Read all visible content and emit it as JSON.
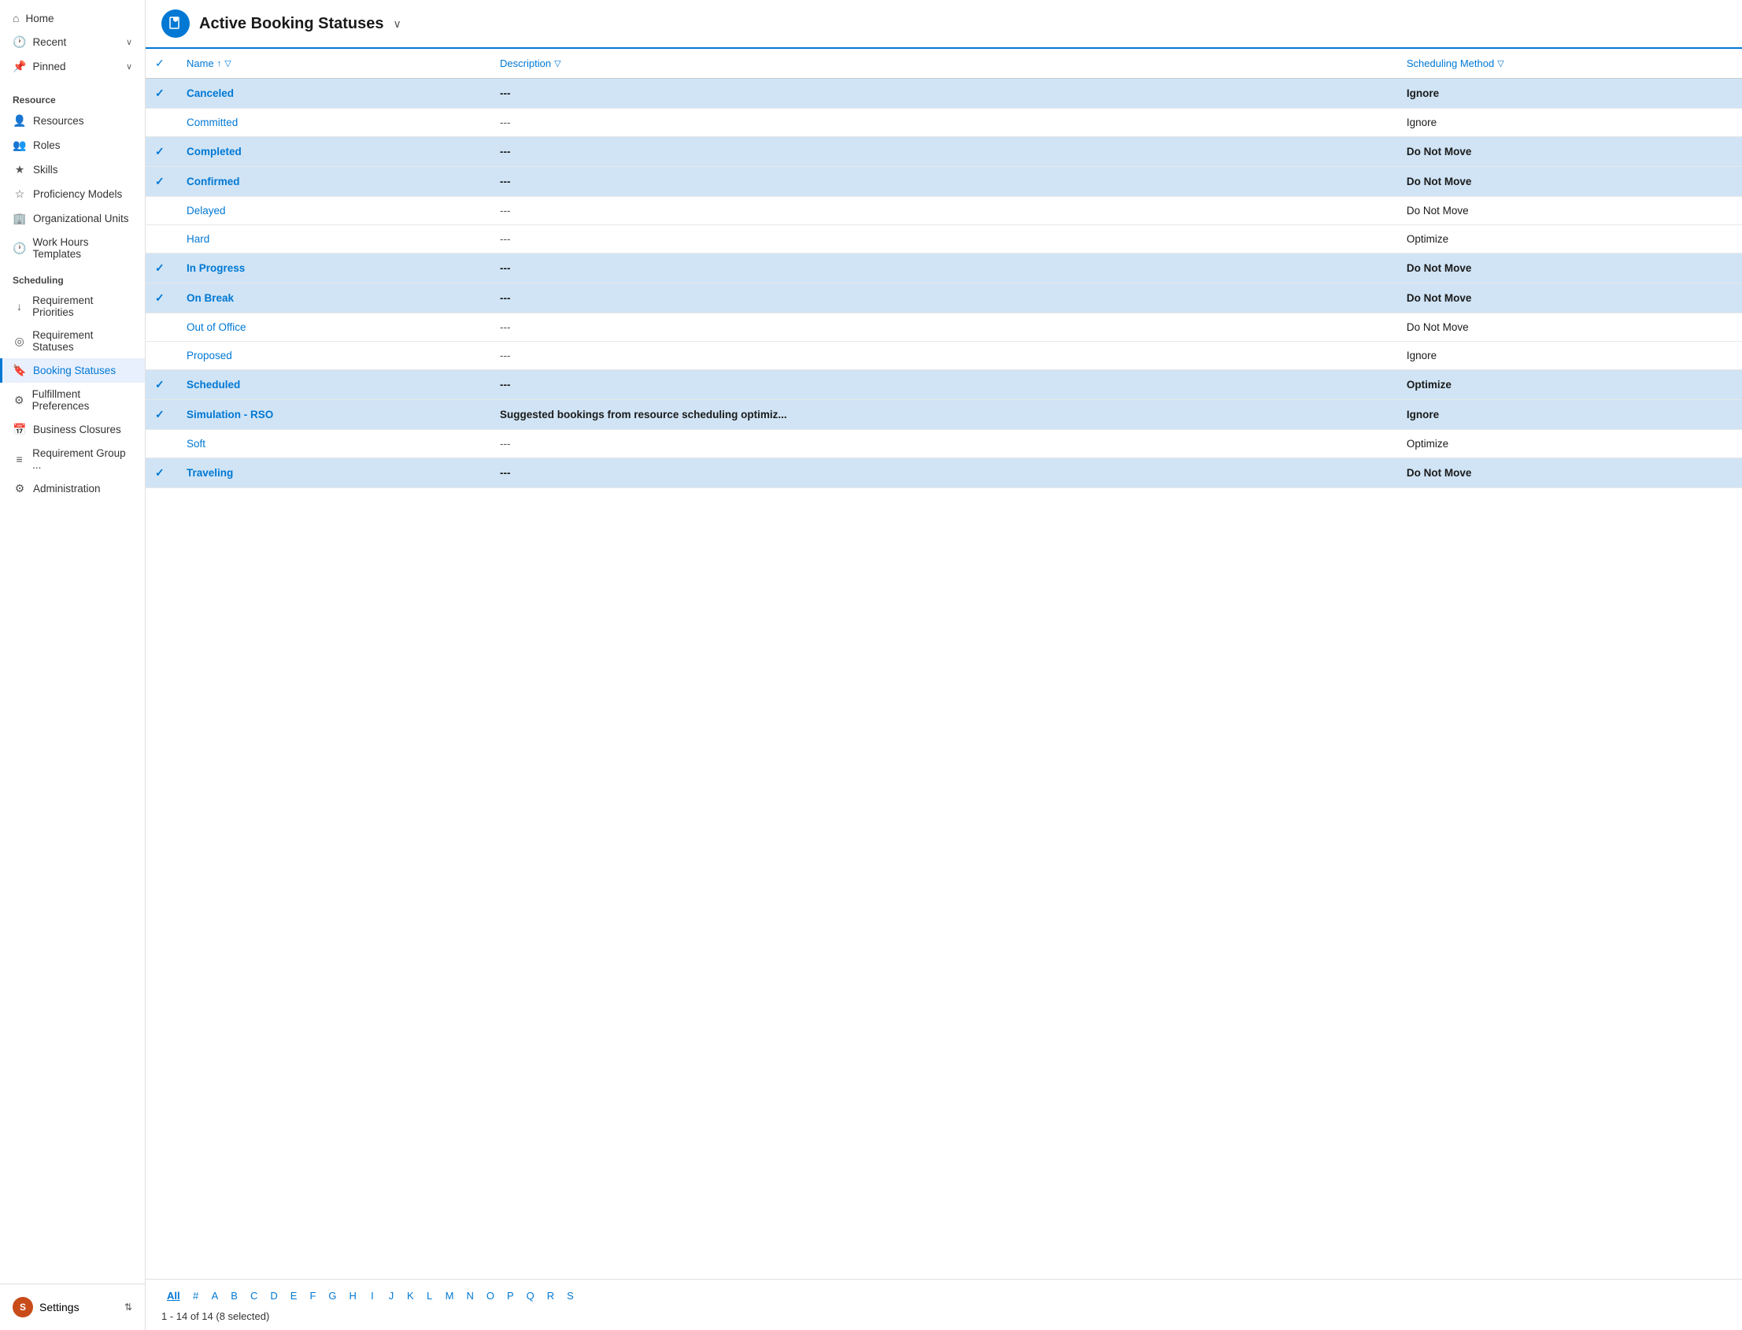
{
  "sidebar": {
    "nav": [
      {
        "id": "home",
        "label": "Home",
        "icon": "⌂"
      },
      {
        "id": "recent",
        "label": "Recent",
        "icon": "🕐",
        "hasChevron": true
      },
      {
        "id": "pinned",
        "label": "Pinned",
        "icon": "📌",
        "hasChevron": true
      }
    ],
    "sections": [
      {
        "label": "Resource",
        "items": [
          {
            "id": "resources",
            "label": "Resources",
            "icon": "👤"
          },
          {
            "id": "roles",
            "label": "Roles",
            "icon": "👥"
          },
          {
            "id": "skills",
            "label": "Skills",
            "icon": "★"
          },
          {
            "id": "proficiency-models",
            "label": "Proficiency Models",
            "icon": "☆"
          },
          {
            "id": "organizational-units",
            "label": "Organizational Units",
            "icon": "🏢"
          },
          {
            "id": "work-hours-templates",
            "label": "Work Hours Templates",
            "icon": "🕐"
          }
        ]
      },
      {
        "label": "Scheduling",
        "items": [
          {
            "id": "requirement-priorities",
            "label": "Requirement Priorities",
            "icon": "↓"
          },
          {
            "id": "requirement-statuses",
            "label": "Requirement Statuses",
            "icon": "◎"
          },
          {
            "id": "booking-statuses",
            "label": "Booking Statuses",
            "icon": "🔖",
            "active": true
          },
          {
            "id": "fulfillment-preferences",
            "label": "Fulfillment Preferences",
            "icon": "⚙"
          },
          {
            "id": "business-closures",
            "label": "Business Closures",
            "icon": "📅"
          },
          {
            "id": "requirement-group",
            "label": "Requirement Group ...",
            "icon": "≡"
          },
          {
            "id": "administration",
            "label": "Administration",
            "icon": "⚙"
          }
        ]
      }
    ],
    "settings": {
      "label": "Settings",
      "avatarLetter": "S",
      "chevron": "⇅"
    }
  },
  "header": {
    "title": "Active Booking Statuses",
    "iconLetter": "🔖"
  },
  "table": {
    "columns": [
      {
        "id": "check",
        "label": "",
        "isCheck": true
      },
      {
        "id": "name",
        "label": "Name",
        "sortable": true,
        "filterable": true
      },
      {
        "id": "description",
        "label": "Description",
        "sortable": false,
        "filterable": true
      },
      {
        "id": "scheduling-method",
        "label": "Scheduling Method",
        "sortable": false,
        "filterable": true
      }
    ],
    "rows": [
      {
        "id": "canceled",
        "name": "Canceled",
        "description": "---",
        "schedulingMethod": "Ignore",
        "selected": true,
        "bold": true
      },
      {
        "id": "committed",
        "name": "Committed",
        "description": "---",
        "schedulingMethod": "Ignore",
        "selected": false,
        "bold": false
      },
      {
        "id": "completed",
        "name": "Completed",
        "description": "---",
        "schedulingMethod": "Do Not Move",
        "selected": true,
        "bold": true
      },
      {
        "id": "confirmed",
        "name": "Confirmed",
        "description": "---",
        "schedulingMethod": "Do Not Move",
        "selected": true,
        "bold": true
      },
      {
        "id": "delayed",
        "name": "Delayed",
        "description": "---",
        "schedulingMethod": "Do Not Move",
        "selected": false,
        "bold": false
      },
      {
        "id": "hard",
        "name": "Hard",
        "description": "---",
        "schedulingMethod": "Optimize",
        "selected": false,
        "bold": false
      },
      {
        "id": "in-progress",
        "name": "In Progress",
        "description": "---",
        "schedulingMethod": "Do Not Move",
        "selected": true,
        "bold": true
      },
      {
        "id": "on-break",
        "name": "On Break",
        "description": "---",
        "schedulingMethod": "Do Not Move",
        "selected": true,
        "bold": true
      },
      {
        "id": "out-of-office",
        "name": "Out of Office",
        "description": "---",
        "schedulingMethod": "Do Not Move",
        "selected": false,
        "bold": false
      },
      {
        "id": "proposed",
        "name": "Proposed",
        "description": "---",
        "schedulingMethod": "Ignore",
        "selected": false,
        "bold": false
      },
      {
        "id": "scheduled",
        "name": "Scheduled",
        "description": "---",
        "schedulingMethod": "Optimize",
        "selected": true,
        "bold": true
      },
      {
        "id": "simulation-rso",
        "name": "Simulation - RSO",
        "description": "Suggested bookings from resource scheduling optimiz...",
        "schedulingMethod": "Ignore",
        "selected": true,
        "bold": true
      },
      {
        "id": "soft",
        "name": "Soft",
        "description": "---",
        "schedulingMethod": "Optimize",
        "selected": false,
        "bold": false
      },
      {
        "id": "traveling",
        "name": "Traveling",
        "description": "---",
        "schedulingMethod": "Do Not Move",
        "selected": true,
        "bold": true
      }
    ]
  },
  "pagination": {
    "letters": [
      "All",
      "#",
      "A",
      "B",
      "C",
      "D",
      "E",
      "F",
      "G",
      "H",
      "I",
      "J",
      "K",
      "L",
      "M",
      "N",
      "O",
      "P",
      "Q",
      "R",
      "S"
    ],
    "activeLetter": "All",
    "info": "1 - 14 of 14 (8 selected)"
  }
}
